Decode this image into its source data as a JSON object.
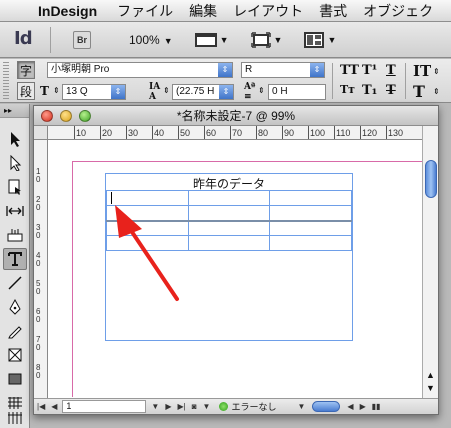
{
  "menubar": {
    "app_name": "InDesign",
    "items": [
      "ファイル",
      "編集",
      "レイアウト",
      "書式",
      "オブジェク"
    ]
  },
  "appbar": {
    "app_logo_text": "Id",
    "bridge_label": "Br",
    "zoom": "100%"
  },
  "control": {
    "char_mode_label": "字",
    "para_mode_label": "段",
    "font_family": "小塚明朝 Pro",
    "font_style": "R",
    "font_size": "13 Q",
    "leading": "(22.75 H",
    "tracking": "0 H"
  },
  "document": {
    "title": "*名称未設定-7 @ 99%",
    "ruler_h": [
      "10",
      "20",
      "30",
      "40",
      "50",
      "60",
      "70",
      "80",
      "90",
      "100",
      "110",
      "120",
      "130"
    ],
    "ruler_v": [
      "1\n0",
      "2\n0",
      "3\n0",
      "4\n0",
      "5\n0",
      "6\n0",
      "7\n0",
      "8\n0"
    ],
    "table_title": "昨年のデータ",
    "table_rows": 4,
    "table_cols": 3,
    "page_number": "1",
    "status_text": "エラーなし"
  },
  "colors": {
    "accent": "#4a7cd0",
    "frame_border": "#6e9ee8",
    "page_edge": "#d86aa8",
    "arrow": "#e8221c",
    "status_ok": "#2b9d16"
  }
}
